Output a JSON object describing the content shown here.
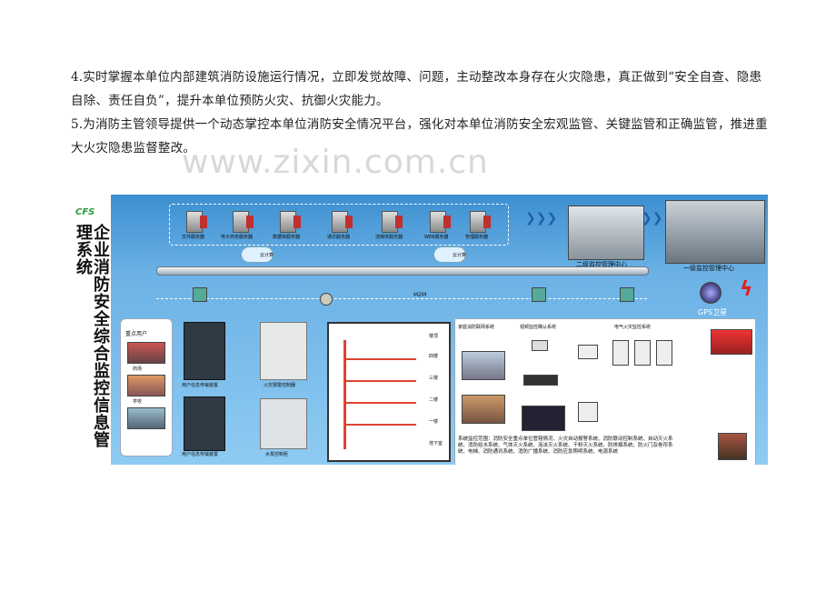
{
  "paragraphs": {
    "p4": "4.实时掌握本单位内部建筑消防设施运行情况，立即发觉故障、问题，主动整改本身存在火灾隐患，真正做到“安全自查、隐患自除、责任自负”，提升本单位预防火灾、抗御火灾能力。",
    "p5": "5.为消防主管领导提供一个动态掌控本单位消防安全情况平台，强化对本单位消防安全宏观监管、关键监管和正确监管，推进重大火灾隐患监督整改。"
  },
  "watermark": "www.zixin.com.cn",
  "figure": {
    "logo": "CFS",
    "title": "企业消防安全综合监控信息管理系统",
    "servers": [
      "文件服务器",
      "电子商务服务器",
      "数据库服务器",
      "通讯服务器",
      "流媒体服务器",
      "WEB服务器",
      "管理服务器"
    ],
    "cloud_labels": [
      "云计算",
      "云计算"
    ],
    "center_level2": "二级监控管理中心",
    "center_level1": "一级监控管理中心",
    "gps": "GPS卫星",
    "m2m": "M2M",
    "key_user": "重点用户",
    "building_names": [
      "商场",
      "学校"
    ],
    "device_labels": [
      "用户信息传输装置",
      "火灾报警控制器",
      "用户信息传输装置",
      "水泵控制柜"
    ],
    "floors": [
      "楼顶",
      "四楼",
      "三楼",
      "二楼",
      "一楼",
      "地下室"
    ],
    "subsystems": [
      "家庭消防联网系统",
      "视频监控确认系统",
      "电气火灾监控系统"
    ],
    "bottom_text": "系统监控范围：消防安全重点单位管辖情况、火灾自动报警系统、消防联动控制系统、自动灭火系统、消防给水系统、气体灭火系统、泡沫灭火系统、干粉灭火系统、防排烟系统、防火门及卷帘系统、电梯、消防通讯系统、消防广播系统、消防应急照明系统、电源系统",
    "colors": {
      "bg_top": "#3d8fd0",
      "bg_bottom": "#8ecbf2",
      "logo": "#2a9a3c",
      "accent": "#d43"
    }
  }
}
